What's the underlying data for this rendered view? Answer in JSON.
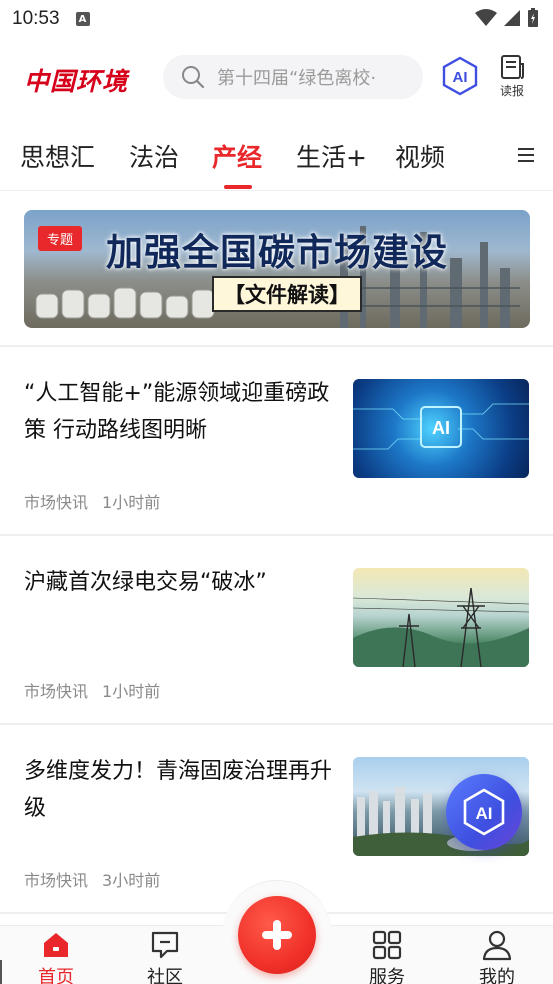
{
  "status_bar": {
    "time": "10:53",
    "notification_badge": "A"
  },
  "header": {
    "logo_text": "中国环境",
    "search_placeholder": "第十四届“绿色离校·",
    "ai_label": "AI",
    "report_label": "读报"
  },
  "tabs": {
    "items": [
      "思想汇",
      "法治",
      "产经",
      "生活+",
      "视频"
    ],
    "active": "产经"
  },
  "banner": {
    "tag": "专题",
    "title": "加强全国碳市场建设",
    "subtitle": "【文件解读】"
  },
  "articles": [
    {
      "title": "“人工智能+”能源领域迎重磅政策 行动路线图明晰",
      "source": "市场快讯",
      "time": "1小时前",
      "thumb_label": "AI"
    },
    {
      "title": "沪藏首次绿电交易“破冰”",
      "source": "市场快讯",
      "time": "1小时前"
    },
    {
      "title": "多维度发力！青海固废治理再升级",
      "source": "市场快讯",
      "time": "3小时前"
    }
  ],
  "floating_ai_label": "AI",
  "bottom_nav": {
    "items": [
      "首页",
      "社区",
      "服务",
      "我的"
    ],
    "active": "首页"
  },
  "colors": {
    "accent": "#e8282b",
    "ai_blue": "#3e4fe0",
    "text": "#111111",
    "meta": "#8a8a8a"
  }
}
